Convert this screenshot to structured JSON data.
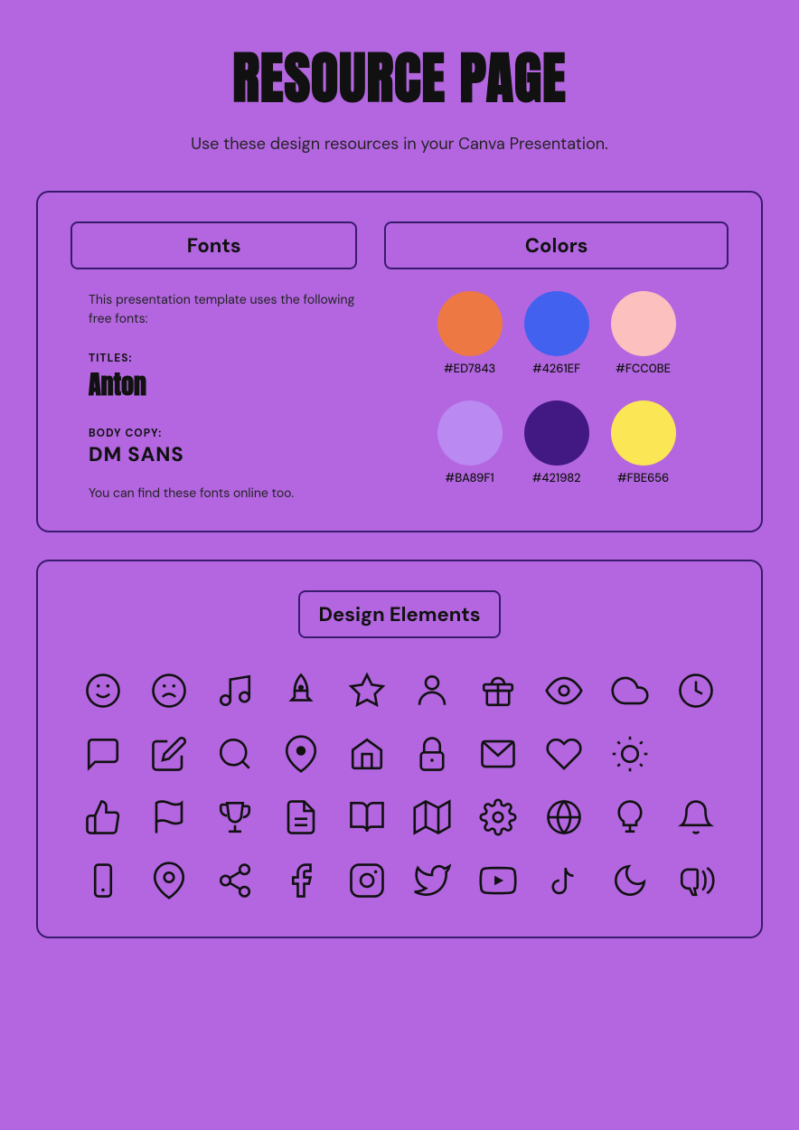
{
  "page": {
    "title": "RESOURCE PAGE",
    "subtitle": "Use these design resources in your Canva Presentation."
  },
  "fonts_section": {
    "header": "Fonts",
    "description": "This presentation template uses the following free fonts:",
    "titles_label": "TITLES:",
    "titles_font": "Anton",
    "bodycopy_label": "BODY COPY:",
    "bodycopy_font": "DM SANS",
    "note": "You can find these fonts online too."
  },
  "colors_section": {
    "header": "Colors",
    "colors": [
      {
        "hex": "#ED7843",
        "label": "#ED7843"
      },
      {
        "hex": "#4261EF",
        "label": "#4261EF"
      },
      {
        "hex": "#FCC0BE",
        "label": "#FCC0BE"
      },
      {
        "hex": "#BA89F1",
        "label": "#BA89F1"
      },
      {
        "hex": "#421982",
        "label": "#421982"
      },
      {
        "hex": "#FBE656",
        "label": "#FBE656"
      }
    ]
  },
  "design_elements": {
    "header": "Design Elements"
  }
}
